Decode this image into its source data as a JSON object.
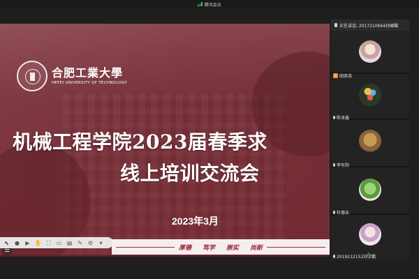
{
  "window": {
    "title": "腾讯会议"
  },
  "slide": {
    "university_cn": "合肥工業大學",
    "university_en": "HEFEI UNIVERSITY OF TECHNOLOGY",
    "title_line1": "机械工程学院2023届春季求",
    "title_line2": "线上培训交流会",
    "date": "2023年3月",
    "motto": [
      "厚德",
      "笃学",
      "崇实",
      "尚新"
    ],
    "accent": "#9b2c35"
  },
  "panel": {
    "speaking_label": "正在讲话: 2017210664孙國楓",
    "participants": [
      {
        "name": "",
        "icon": "avatar-girl-icon"
      },
      {
        "name": "田崇浩",
        "icon": "avatar-balloons-icon",
        "host": true
      },
      {
        "name": "陈泽鑫",
        "icon": "avatar-desert-icon"
      },
      {
        "name": "李东阳",
        "icon": "avatar-cartoon-icon"
      },
      {
        "name": "杜德业",
        "icon": "avatar-anime-icon"
      },
      {
        "name": "2019212152刘宇鹏",
        "icon": "avatar-icon"
      }
    ]
  }
}
